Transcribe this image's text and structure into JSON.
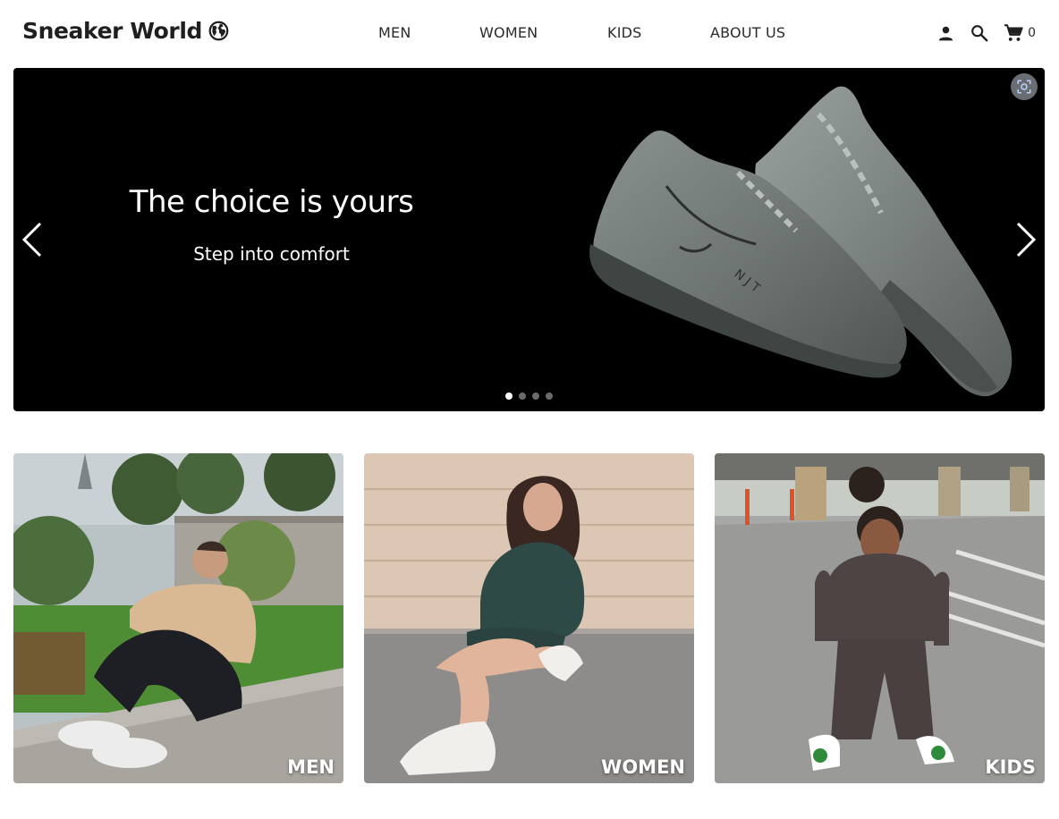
{
  "header": {
    "logo_text": "Sneaker World",
    "nav": [
      "MEN",
      "WOMEN",
      "KIDS",
      "ABOUT US"
    ],
    "icons": [
      "user-icon",
      "search-icon",
      "cart-icon"
    ],
    "cart_count": "0"
  },
  "hero": {
    "title": "The choice is yours",
    "subtitle": "Step into comfort",
    "slides_total": 4,
    "active_slide": 1
  },
  "categories": [
    {
      "label": "MEN"
    },
    {
      "label": "WOMEN"
    },
    {
      "label": "KIDS"
    }
  ]
}
